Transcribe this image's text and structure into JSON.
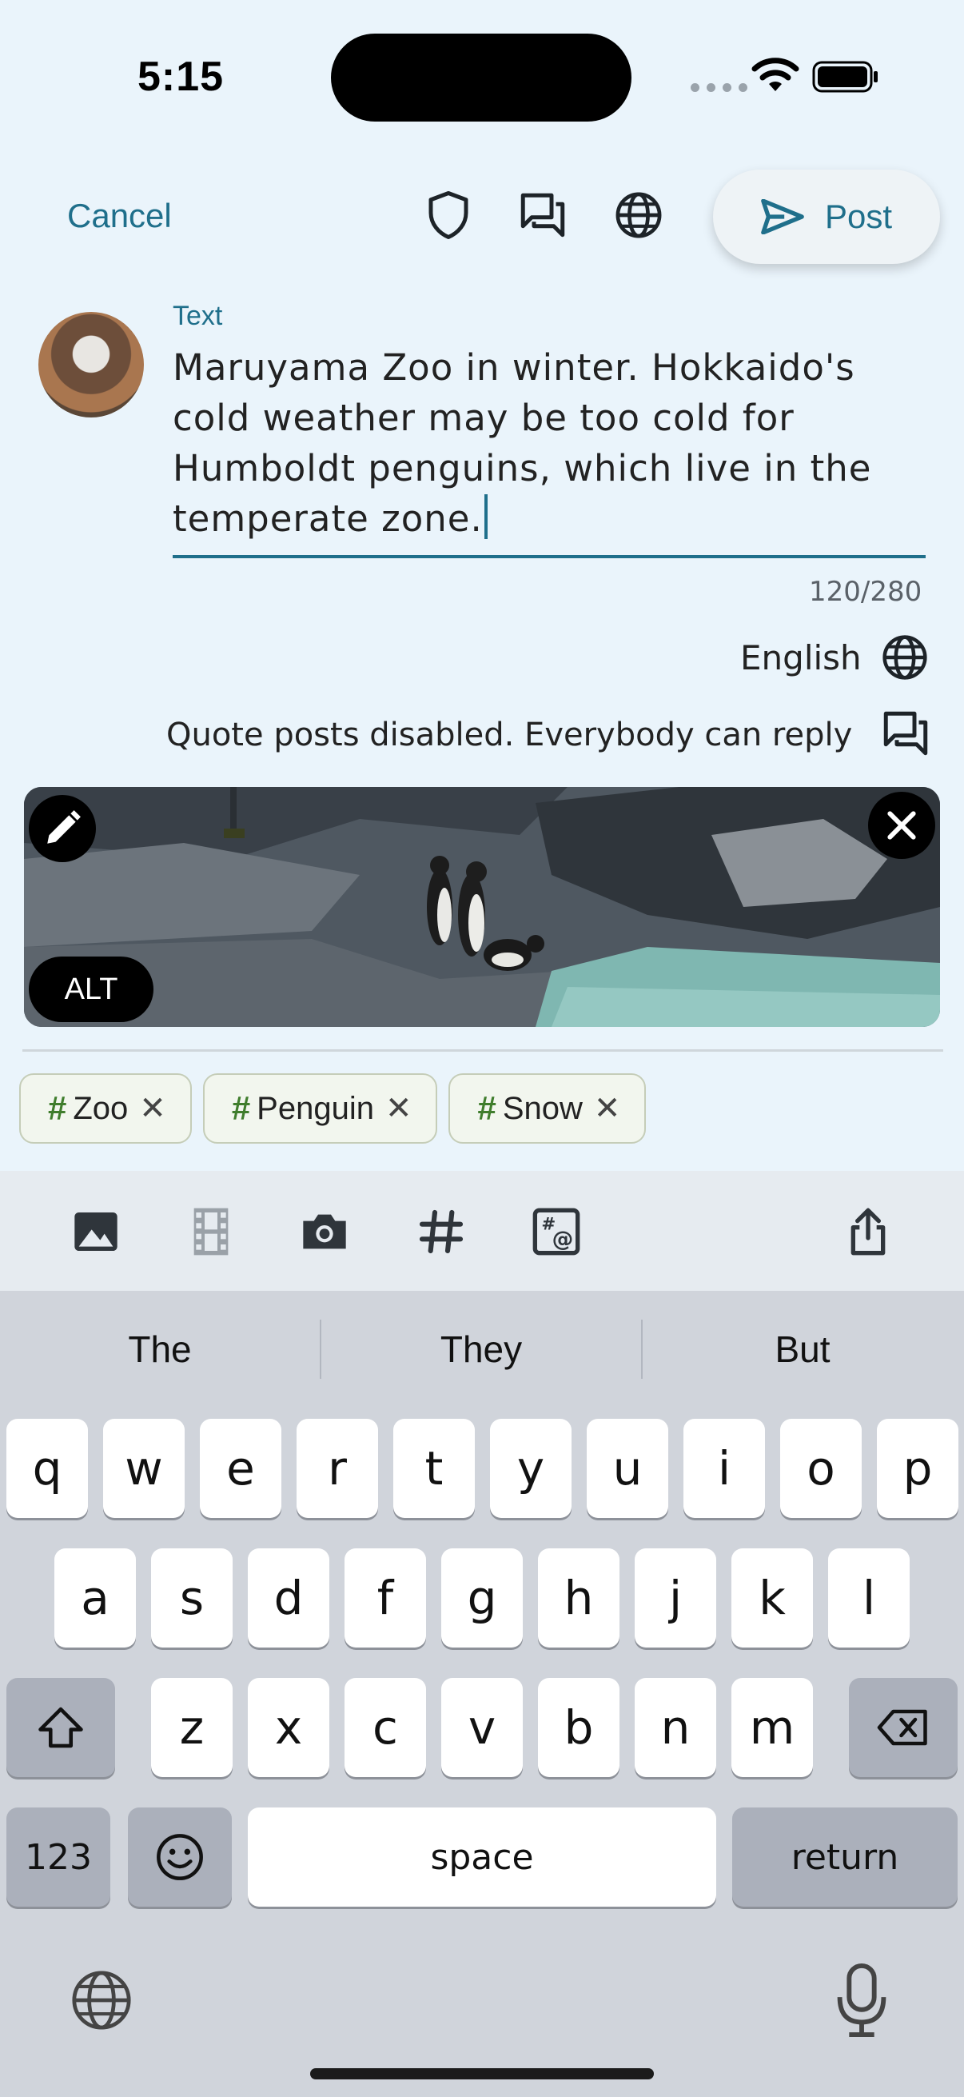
{
  "status_bar": {
    "time": "5:15"
  },
  "toolbar": {
    "cancel_label": "Cancel",
    "post_label": "Post"
  },
  "composer": {
    "field_label": "Text",
    "text": "Maruyama Zoo in winter. Hokkaido's cold weather may be too cold for Humboldt penguins, which live in the temperate zone.",
    "char_count": "120/280",
    "language": "English",
    "interaction_settings": "Quote posts disabled. Everybody can reply"
  },
  "attachment": {
    "alt_label": "ALT"
  },
  "hashtags": [
    {
      "label": "Zoo"
    },
    {
      "label": "Penguin"
    },
    {
      "label": "Snow"
    }
  ],
  "keyboard": {
    "suggestions": [
      "The",
      "They",
      "But"
    ],
    "row1": [
      "q",
      "w",
      "e",
      "r",
      "t",
      "y",
      "u",
      "i",
      "o",
      "p"
    ],
    "row2": [
      "a",
      "s",
      "d",
      "f",
      "g",
      "h",
      "j",
      "k",
      "l"
    ],
    "row3": [
      "z",
      "x",
      "c",
      "v",
      "b",
      "n",
      "m"
    ],
    "numbers_label": "123",
    "space_label": "space",
    "return_label": "return"
  },
  "colors": {
    "accent": "#1f6f8b",
    "background": "#eaf4fb",
    "hashtag": "#3f7d2c"
  }
}
